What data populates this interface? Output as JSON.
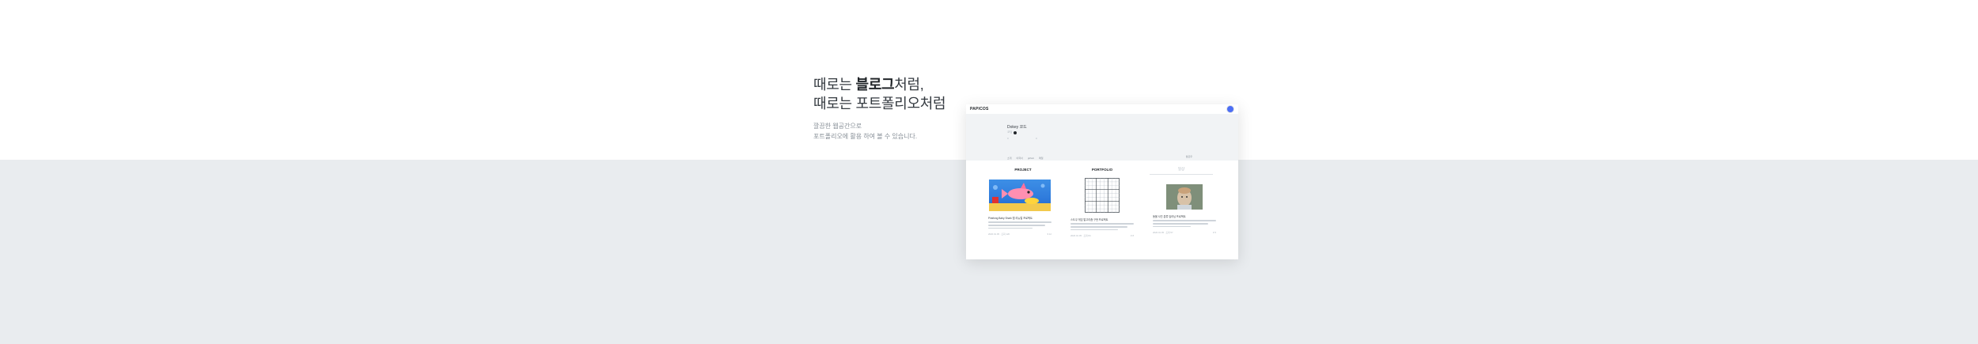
{
  "hero": {
    "line1_pre": "때로는 ",
    "line1_bold": "블로그",
    "line1_post": "처럼,",
    "line2": "때로는 포트폴리오처럼",
    "desc1": "깔끔한 웹공간으로",
    "desc2": "포트폴리오에 활용 하여 볼 수 있습니다."
  },
  "mockup": {
    "logo": "PAPICOS",
    "profile": {
      "name": "Dokey 코드",
      "badge": "코딩",
      "stats": [
        "0",
        "0"
      ],
      "links": [
        "소개",
        "이력서",
        "github",
        "메일"
      ],
      "follow": "팔로우"
    },
    "tabs": [
      "PROJECT",
      "PORTFOLIO",
      "일상"
    ],
    "cards": [
      {
        "title": "Pinkfong Baby Shark 앱 리뉴얼 프로젝트",
        "meta_left": "2020.01.05 · 조회 120",
        "meta_right": "♥ 12"
      },
      {
        "title": "스도쿠 게임 알고리즘 구현 프로젝트",
        "meta_left": "2020.01.05 · 조회 84",
        "meta_right": "♥ 8"
      },
      {
        "title": "동물 사진 분류 딥러닝 프로젝트",
        "meta_left": "2020.01.05 · 조회 57",
        "meta_right": "♥ 5"
      }
    ]
  },
  "colors": {
    "band": "#e9ecef",
    "accent": "#4c6ef5"
  }
}
